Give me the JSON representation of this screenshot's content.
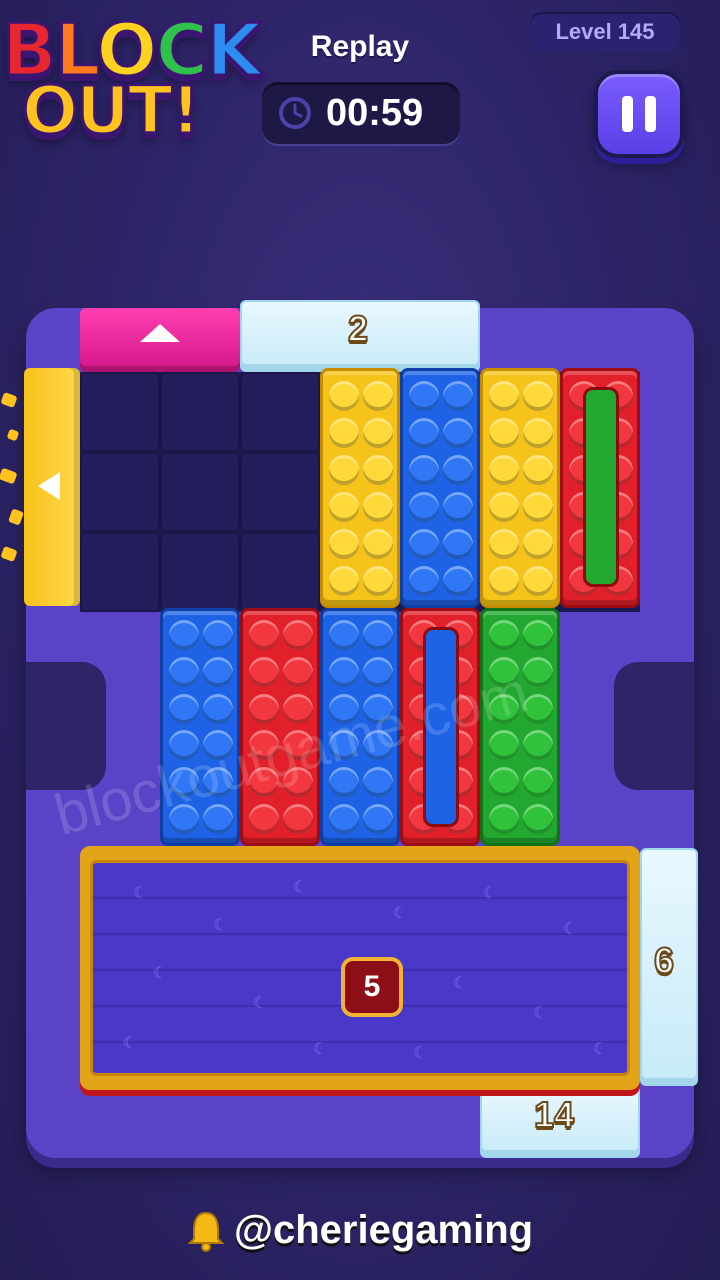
{
  "logo": {
    "line1": [
      "B",
      "L",
      "O",
      "C",
      "K"
    ],
    "line2": "OUT!"
  },
  "header": {
    "mode_label": "Replay",
    "timer": "00:59",
    "level": "Level 145"
  },
  "board": {
    "top_ice_counter": "2",
    "right_ice_counter": "6",
    "bottom_ice_counter": "14",
    "big_block_counter": "5"
  },
  "watermark": "blockoutgame.com",
  "footer": {
    "handle": "@cheriegaming"
  },
  "colors": {
    "yellow": "#f5c31a",
    "blue": "#1e63e6",
    "red": "#e2202a",
    "green": "#22a830",
    "pink_gate": "#ff3fb0",
    "board": "#5a43c6",
    "background": "#2c2466"
  },
  "icons": {
    "timer": "clock-icon",
    "pause": "pause-icon",
    "footer": "bell-icon"
  }
}
